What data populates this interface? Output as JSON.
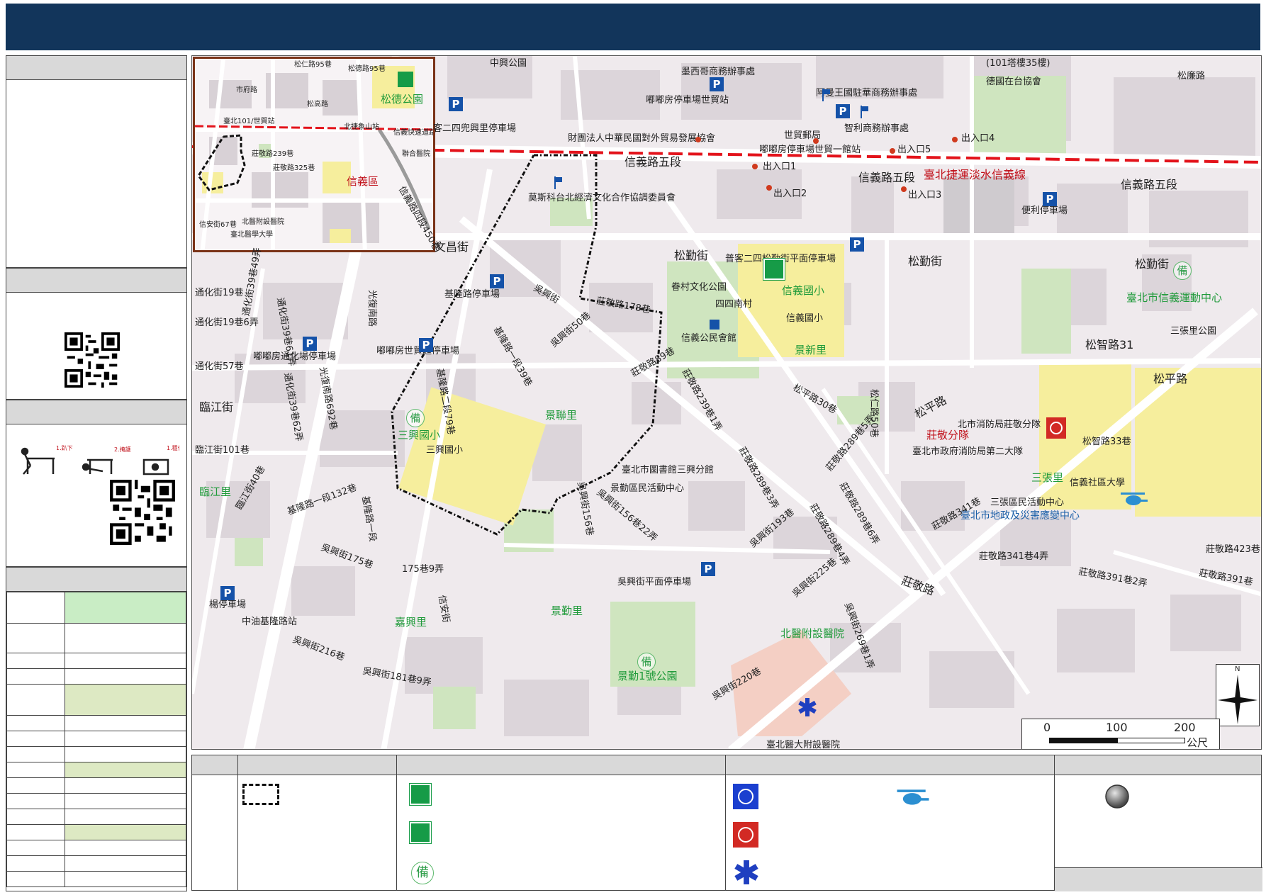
{
  "map": {
    "inset_labels": {
      "songde_95": "松德路95巷",
      "songren_95": "松仁路95巷",
      "songde_park": "松德公園",
      "shifu": "市府路",
      "songgao": "松高路",
      "songren": "松仁路",
      "mrt_station": "臺北101/世貿站",
      "xiangshan": "北捷象山站",
      "xinyi_express": "信義快速道路",
      "lianhe": "聯合醫院",
      "xinyi_district": "信義區",
      "zhuangjing239": "莊敬路239巷",
      "zhuangjing325": "莊敬路325巷",
      "xinyi_67": "信安街67巷",
      "tmu_hospital": "北醫附設醫院",
      "tmu": "臺北醫學大學"
    },
    "streets": {
      "zhongxing_park": "中興公園",
      "mexico_office": "墨西哥商務辦事處",
      "101": "(101塔樓35樓)",
      "german_institute": "德國在台協會",
      "songlian": "松廉路",
      "cc_parking": "嘟嘟房停車場世貿站",
      "arab_office": "阿曼王國駐華商務辦事處",
      "chinese_zhongxing": "客二四兜興里",
      "parking_zhongxing": "客二四兜興里停車場",
      "trade_assoc": "財團法人中華民國對外貿易發展協會",
      "world_trade_po": "世貿郵局",
      "zhili_office": "智利商務辦事處",
      "exit4": "出入口4",
      "exit5": "出入口5",
      "exit1": "出入口1",
      "cc_parking2": "嘟嘟房停車場世貿一館站",
      "xinyi5": "信義路五段",
      "xinyi5b": "信義路五段",
      "xinyi5c": "信義路五段",
      "red_line": "臺北捷運淡水信義線",
      "exit2": "出入口2",
      "exit3": "出入口3",
      "moscow": "莫斯科台北經濟文化合作協調委員會",
      "xinyi_qu_450": "信義路四段450巷",
      "wenchang": "文昌街",
      "convenience_parking": "便利停車場",
      "songqin": "松勤街",
      "songqin2": "松勤街",
      "songqin3": "松勤街",
      "zhuangjing": "莊敬路",
      "songqin_parking": "普客二四松勤街平面停車場",
      "chuncun": "眷村文化公園",
      "sisi": "四四南村",
      "xinyi_elem": "信義國小",
      "xinyi_elem2": "信義國小",
      "xinyi_hall": "信義公民會館",
      "jingxin": "景新里",
      "sports_center": "臺北市信義運動中心",
      "sanzhang_park": "三張里公園",
      "songzhi31": "松智路31",
      "songping": "松平路",
      "songping2": "松平路",
      "songzhi33": "松智路33巷",
      "tonghua19": "通化街19巷",
      "tonghua19_6": "通化街19巷6弄",
      "tonghua39_61": "通化街39巷61弄",
      "tonghua39_49": "通化街39巷49弄",
      "keelung_parking": "基隆路停車場",
      "guangfu_south": "光復南路",
      "tonghua_parking": "嘟嘟房通化場停車場",
      "trade_parking": "嘟嘟房世貿超停車場",
      "tonghua57": "通化街57巷",
      "tonghua39_62": "通化街39巷62弄",
      "guangfu692": "光復南路692巷",
      "linjiang": "臨江街",
      "linjiang101": "臨江街101巷",
      "linjiang_li": "臨江里",
      "linjiang40": "臨江街40巷",
      "keelung1_132": "基隆路一段132巷",
      "keelung1": "基隆路一段",
      "wuxing": "吳興街",
      "wuxing50": "吳興街50巷",
      "keelung_1_39": "基隆路一段39巷",
      "keelung_1_79": "基隆路二段79巷",
      "zhuangjing178": "莊敬路178巷",
      "zhuangjing89": "莊敬路89巷",
      "zhuangjing239_1": "莊敬路239巷1弄",
      "jingzhong": "景聯里",
      "sanxing_elem": "三興國小",
      "sanxing_elem2": "三興國小",
      "library": "臺北市圖書館三興分館",
      "jingqin_center": "景勤區民活動中心",
      "wuxing156": "吳興街156巷",
      "wuxing156_22": "吳興街156巷22弄",
      "wuxing_parking": "吳興街平面停車場",
      "zhuangjing289_3": "莊敬路289巷3弄",
      "zhuangjing289_5": "莊敬路289巷5弄",
      "songping30": "松平路30巷",
      "songren50": "松仁路50巷",
      "zhuangjing_branch": "莊敬分隊",
      "fire_dept": "臺北市政府消防局第二大隊",
      "fire_zhuangjing": "北市消防局莊敬分隊",
      "sanzhang": "三張里",
      "xinyi_uni": "信義社區大學",
      "sanzhang_center": "三張區民活動中心",
      "disaster_center": "臺北市地政及災害應變中心",
      "zhuangjing341": "莊敬路341巷",
      "zhuangjing341_4": "莊敬路341巷4弄",
      "zhuangjing391_2": "莊敬路391巷2弄",
      "zhuangjing423": "莊敬路423巷",
      "zhuangjing391": "莊敬路391巷",
      "zhuangjing289_6": "莊敬路289巷6弄",
      "zhuangjing289_4": "莊敬路289巷4弄",
      "wuxing193": "吳興街193巷",
      "wuxing225": "吳興街225巷",
      "zhuangjing_road": "莊敬路",
      "wuxing220": "吳興街220巷",
      "wuxing269_1": "吳興街269巷1弄",
      "tmu_hosp_main": "北醫附設醫院",
      "tmu_hosp_sub": "臺北醫大附設醫院",
      "wuxing175": "吳興街175巷",
      "wuxing175_9": "175巷9弄",
      "jiaxing": "嘉興里",
      "xinan": "信安街",
      "jingqin": "景勤里",
      "jingqin_park": "景勤1號公園",
      "yang_parking": "楊停車場",
      "cpc_keelung": "中油基隆路站",
      "wuxing216": "吳興街216巷",
      "wuxing181_9": "吳興街181巷9弄"
    },
    "compass_n": "N",
    "scale": {
      "t0": "0",
      "t1": "100",
      "t2": "200",
      "unit": "公尺"
    },
    "bei": "備"
  },
  "colors": {
    "title_bg": "#12355b",
    "park_green": "#cfe5bf",
    "school_yellow": "#f6ee9d",
    "mrt_red": "#e3131b",
    "shelter_green": "#169b47",
    "parking_blue": "#1552a8",
    "boundary": "#111111"
  },
  "icons": [
    "parking-icon",
    "flag-icon",
    "shelter-icon",
    "bei-icon",
    "police-icon",
    "fire-icon",
    "helicopter-icon",
    "medical-icon",
    "compass-icon",
    "qr-code-icon",
    "quake-safety-icon"
  ]
}
